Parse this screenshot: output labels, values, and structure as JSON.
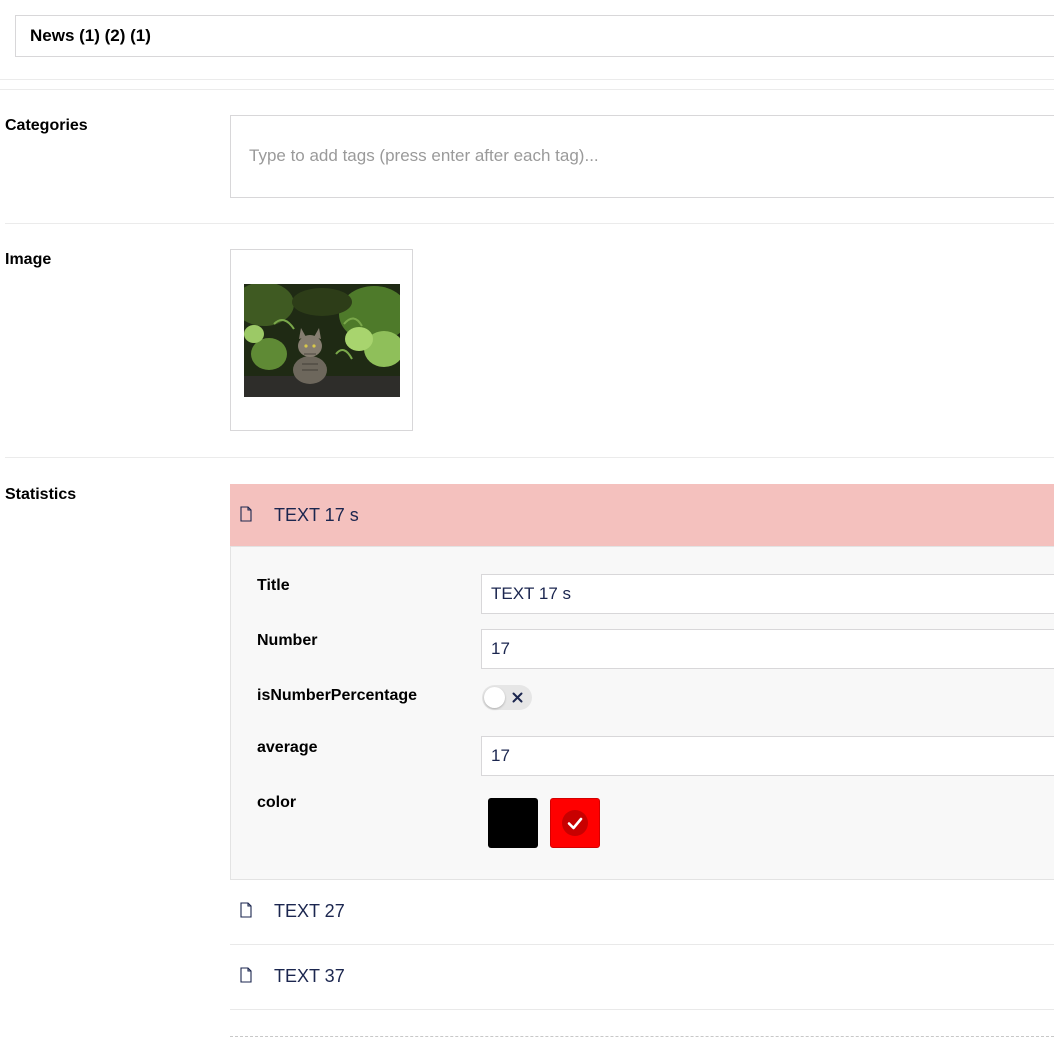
{
  "node": {
    "name": "News (1) (2) (1)"
  },
  "properties": {
    "categories": {
      "label": "Categories",
      "placeholder": "Type to add tags (press enter after each tag)..."
    },
    "image": {
      "label": "Image"
    },
    "statistics": {
      "label": "Statistics",
      "items": [
        {
          "title": "TEXT 17 s",
          "expanded": true
        },
        {
          "title": "TEXT 27",
          "expanded": false
        },
        {
          "title": "TEXT 37",
          "expanded": false
        }
      ],
      "editor": {
        "title_label": "Title",
        "title_value": "TEXT 17 s",
        "number_label": "Number",
        "number_value": "17",
        "is_percentage_label": "isNumberPercentage",
        "is_percentage_on": false,
        "average_label": "average",
        "average_value": "17",
        "color_label": "color",
        "colors": [
          {
            "hex": "#000000",
            "selected": false
          },
          {
            "hex": "#ff0000",
            "selected": true
          }
        ]
      }
    }
  },
  "colors": {
    "active_item_bg": "#f4c1be",
    "text": "#1b264f"
  }
}
